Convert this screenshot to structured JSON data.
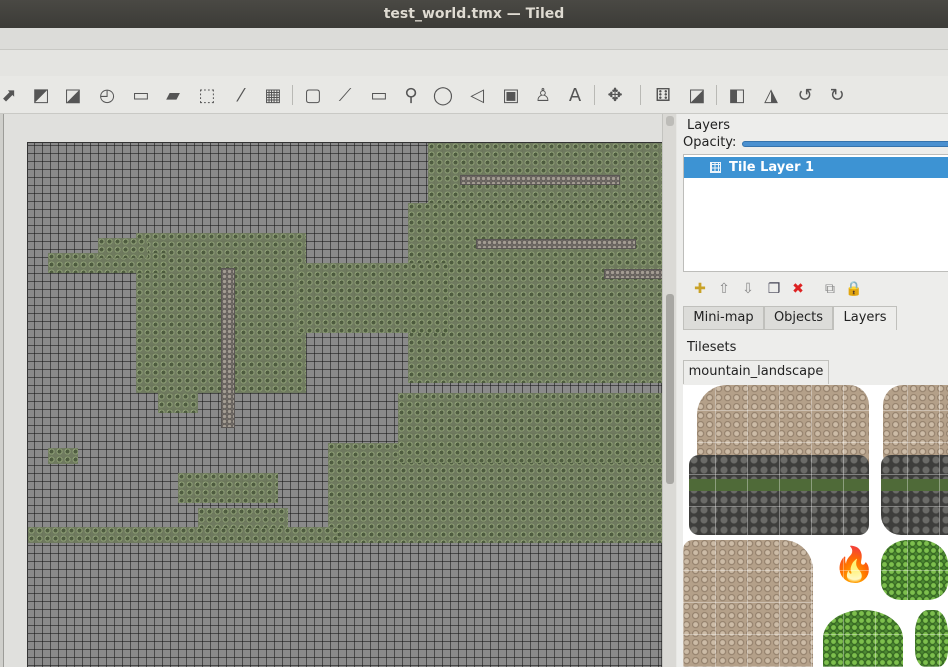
{
  "window": {
    "title": "test_world.tmx — Tiled"
  },
  "toolbar": {
    "tools": [
      {
        "name": "stamp-brush-icon",
        "glyph": "⬈"
      },
      {
        "name": "terrain-brush-icon",
        "glyph": "◩"
      },
      {
        "name": "wang-brush-icon",
        "glyph": "◪"
      },
      {
        "name": "bucket-fill-icon",
        "glyph": "◴"
      },
      {
        "name": "shape-fill-icon",
        "glyph": "▭"
      },
      {
        "name": "eraser-icon",
        "glyph": "▰"
      },
      {
        "name": "rectangle-select-icon",
        "glyph": "⬚"
      },
      {
        "name": "magic-wand-icon",
        "glyph": "⁄"
      },
      {
        "name": "select-same-tile-icon",
        "glyph": "▦"
      },
      {
        "name": "select-objects-icon",
        "glyph": "▢"
      },
      {
        "name": "edit-polygons-icon",
        "glyph": "⟋"
      },
      {
        "name": "insert-rectangle-icon",
        "glyph": "▭"
      },
      {
        "name": "insert-point-icon",
        "glyph": "⚲"
      },
      {
        "name": "insert-ellipse-icon",
        "glyph": "◯"
      },
      {
        "name": "insert-polygon-icon",
        "glyph": "◁"
      },
      {
        "name": "insert-tile-icon",
        "glyph": "▣"
      },
      {
        "name": "insert-template-icon",
        "glyph": "♙"
      },
      {
        "name": "insert-text-icon",
        "glyph": "A"
      },
      {
        "name": "move-icon",
        "glyph": "✥"
      },
      {
        "name": "random-mode-icon",
        "glyph": "⚅"
      },
      {
        "name": "wang-fill-icon",
        "glyph": "◪"
      },
      {
        "name": "flip-horizontal-icon",
        "glyph": "◧"
      },
      {
        "name": "flip-vertical-icon",
        "glyph": "◮"
      },
      {
        "name": "rotate-left-icon",
        "glyph": "↺"
      },
      {
        "name": "rotate-right-icon",
        "glyph": "↻"
      }
    ]
  },
  "layers_panel": {
    "title": "Layers",
    "opacity_label": "Opacity:",
    "opacity": 1.0,
    "layers": [
      {
        "name": "Tile Layer 1",
        "selected": true
      }
    ]
  },
  "layer_buttons": [
    {
      "name": "new-layer-icon",
      "glyph": "✚"
    },
    {
      "name": "raise-layer-icon",
      "glyph": "⇧"
    },
    {
      "name": "lower-layer-icon",
      "glyph": "⇩"
    },
    {
      "name": "duplicate-layer-icon",
      "glyph": "❐"
    },
    {
      "name": "remove-layer-icon",
      "glyph": "✖"
    },
    {
      "name": "merge-layer-icon",
      "glyph": "⧉"
    },
    {
      "name": "lock-layer-icon",
      "glyph": "🔒"
    }
  ],
  "dock_tabs": [
    {
      "label": "Mini-map",
      "active": false
    },
    {
      "label": "Objects",
      "active": false
    },
    {
      "label": "Layers",
      "active": true
    }
  ],
  "tilesets_panel": {
    "title": "Tilesets",
    "tabs": [
      {
        "label": "mountain_landscape",
        "active": true
      }
    ]
  },
  "colors": {
    "selection": "#3d93d3",
    "map_background": "#8a8a8a",
    "vegetation": "#6e7a5d"
  }
}
